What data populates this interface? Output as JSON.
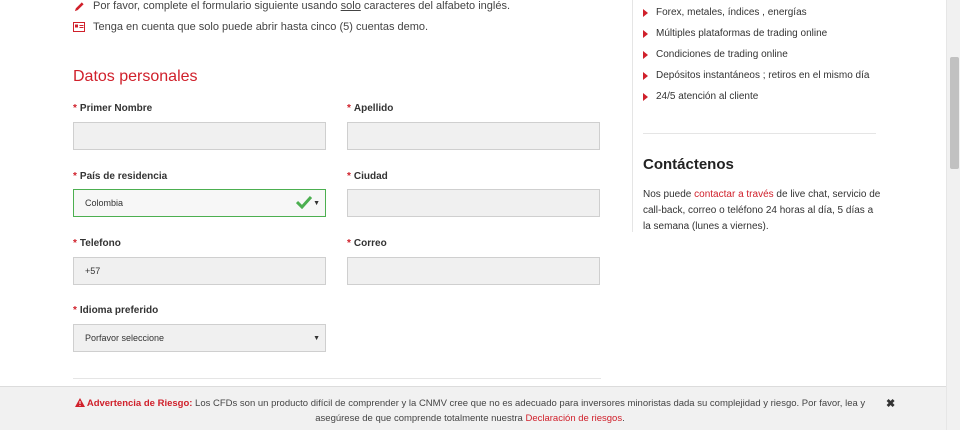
{
  "notes": {
    "note1_before": "Por favor, complete el formulario siguiente usando ",
    "note1_underlined": "solo",
    "note1_after": " caracteres del alfabeto inglés.",
    "note2": "Tenga en cuenta que solo puede abrir hasta cinco (5) cuentas demo."
  },
  "section_title": "Datos personales",
  "form": {
    "required_mark": "*",
    "first_name_label": "Primer Nombre",
    "last_name_label": "Apellido",
    "country_label": "País de residencia",
    "country_value": "Colombia",
    "city_label": "Ciudad",
    "phone_label": "Telefono",
    "phone_value": "+57",
    "email_label": "Correo",
    "language_label": "Idioma preferido",
    "language_value": "Porfavor seleccione"
  },
  "features": [
    "Forex, metales, índices , energías",
    "Múltiples plataformas de trading online",
    "Condiciones de trading online",
    "Depósitos instantáneos ; retiros en el mismo día",
    "24/5 atención al cliente"
  ],
  "contact": {
    "title": "Contáctenos",
    "text_before": "Nos puede ",
    "link": "contactar a través",
    "text_after": " de live chat, servicio de call-back, correo o teléfono 24 horas al día, 5 días a la semana (lunes a viernes)."
  },
  "risk_banner": {
    "label": "Advertencia de Riesgo:",
    "text": " Los CFDs son un producto difícil de comprender y la CNMV cree que no es adecuado para inversores minoristas dada su complejidad y riesgo. Por favor, lea y asegúrese de que comprende totalmente nuestra ",
    "link": "Declaración de riesgos",
    "end": ".",
    "close": "✖"
  },
  "colors": {
    "accent": "#d0202b",
    "valid": "#4caf50"
  }
}
